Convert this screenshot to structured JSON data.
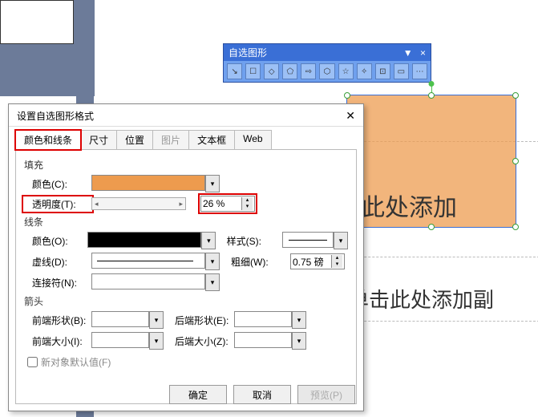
{
  "toolbar": {
    "title": "自选图形",
    "menu_icon": "▼",
    "close_icon": "×",
    "icons": [
      "⬚",
      "⬚",
      "⬚",
      "⬚",
      "⬚",
      "⬚",
      "⬚",
      "⬚",
      "⬚",
      "⬚",
      "⬚"
    ]
  },
  "placeholders": {
    "title_text": "击此处添加",
    "subtitle_text": "单击此处添加副"
  },
  "dialog": {
    "title": "设置自选图形格式",
    "tabs": {
      "colors_lines": "颜色和线条",
      "size": "尺寸",
      "position": "位置",
      "picture": "图片",
      "textbox": "文本框",
      "web": "Web"
    },
    "fill": {
      "group": "填充",
      "color_label": "颜色(C):",
      "color_value": "#ed9b4e",
      "transparency_label": "透明度(T):",
      "transparency_value": "26 %"
    },
    "line": {
      "group": "线条",
      "color_label": "颜色(O):",
      "style_label": "样式(S):",
      "dash_label": "虚线(D):",
      "weight_label": "粗细(W):",
      "weight_value": "0.75 磅",
      "connector_label": "连接符(N):"
    },
    "arrow": {
      "group": "箭头",
      "begin_style": "前端形状(B):",
      "end_style": "后端形状(E):",
      "begin_size": "前端大小(I):",
      "end_size": "后端大小(Z):"
    },
    "default_chk": "新对象默认值(F)",
    "buttons": {
      "ok": "确定",
      "cancel": "取消",
      "preview": "预览(P)"
    }
  }
}
